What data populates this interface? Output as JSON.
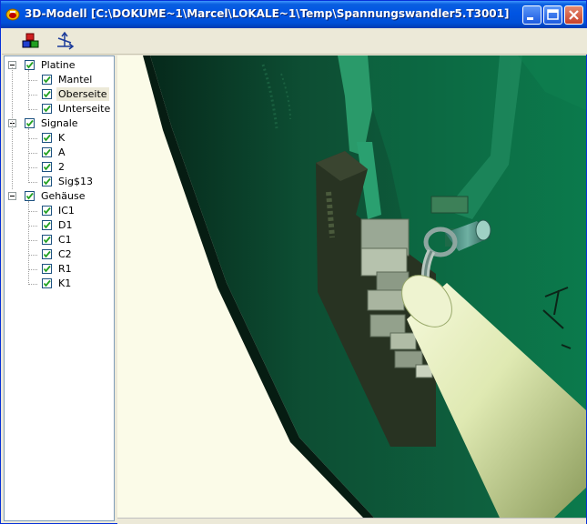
{
  "window": {
    "title": "3D-Modell  [C:\\DOKUME~1\\Marcel\\LOKALE~1\\Temp\\Spannungswandler5.T3001]"
  },
  "toolbar": {
    "tools": [
      {
        "name": "color-tool",
        "icon": "colored-cubes-icon"
      },
      {
        "name": "axis-tool",
        "icon": "axis-icon"
      }
    ]
  },
  "tree": {
    "groups": [
      {
        "label": "Platine",
        "checked": true,
        "children": [
          {
            "label": "Mantel",
            "checked": true
          },
          {
            "label": "Oberseite",
            "checked": true,
            "selected": true
          },
          {
            "label": "Unterseite",
            "checked": true
          }
        ]
      },
      {
        "label": "Signale",
        "checked": true,
        "children": [
          {
            "label": "K",
            "checked": true
          },
          {
            "label": "A",
            "checked": true
          },
          {
            "label": "2",
            "checked": true
          },
          {
            "label": "Sig$13",
            "checked": true
          }
        ]
      },
      {
        "label": "Gehäuse",
        "checked": true,
        "children": [
          {
            "label": "IC1",
            "checked": true
          },
          {
            "label": "D1",
            "checked": true
          },
          {
            "label": "C1",
            "checked": true
          },
          {
            "label": "C2",
            "checked": true
          },
          {
            "label": "R1",
            "checked": true
          },
          {
            "label": "K1",
            "checked": true
          }
        ]
      }
    ]
  },
  "colors": {
    "title_bar": "#0054e3",
    "board_green": "#0d5a3c",
    "board_light": "#1e7a55",
    "background": "#fbfbe8",
    "capacitor": "#e6efbe"
  }
}
